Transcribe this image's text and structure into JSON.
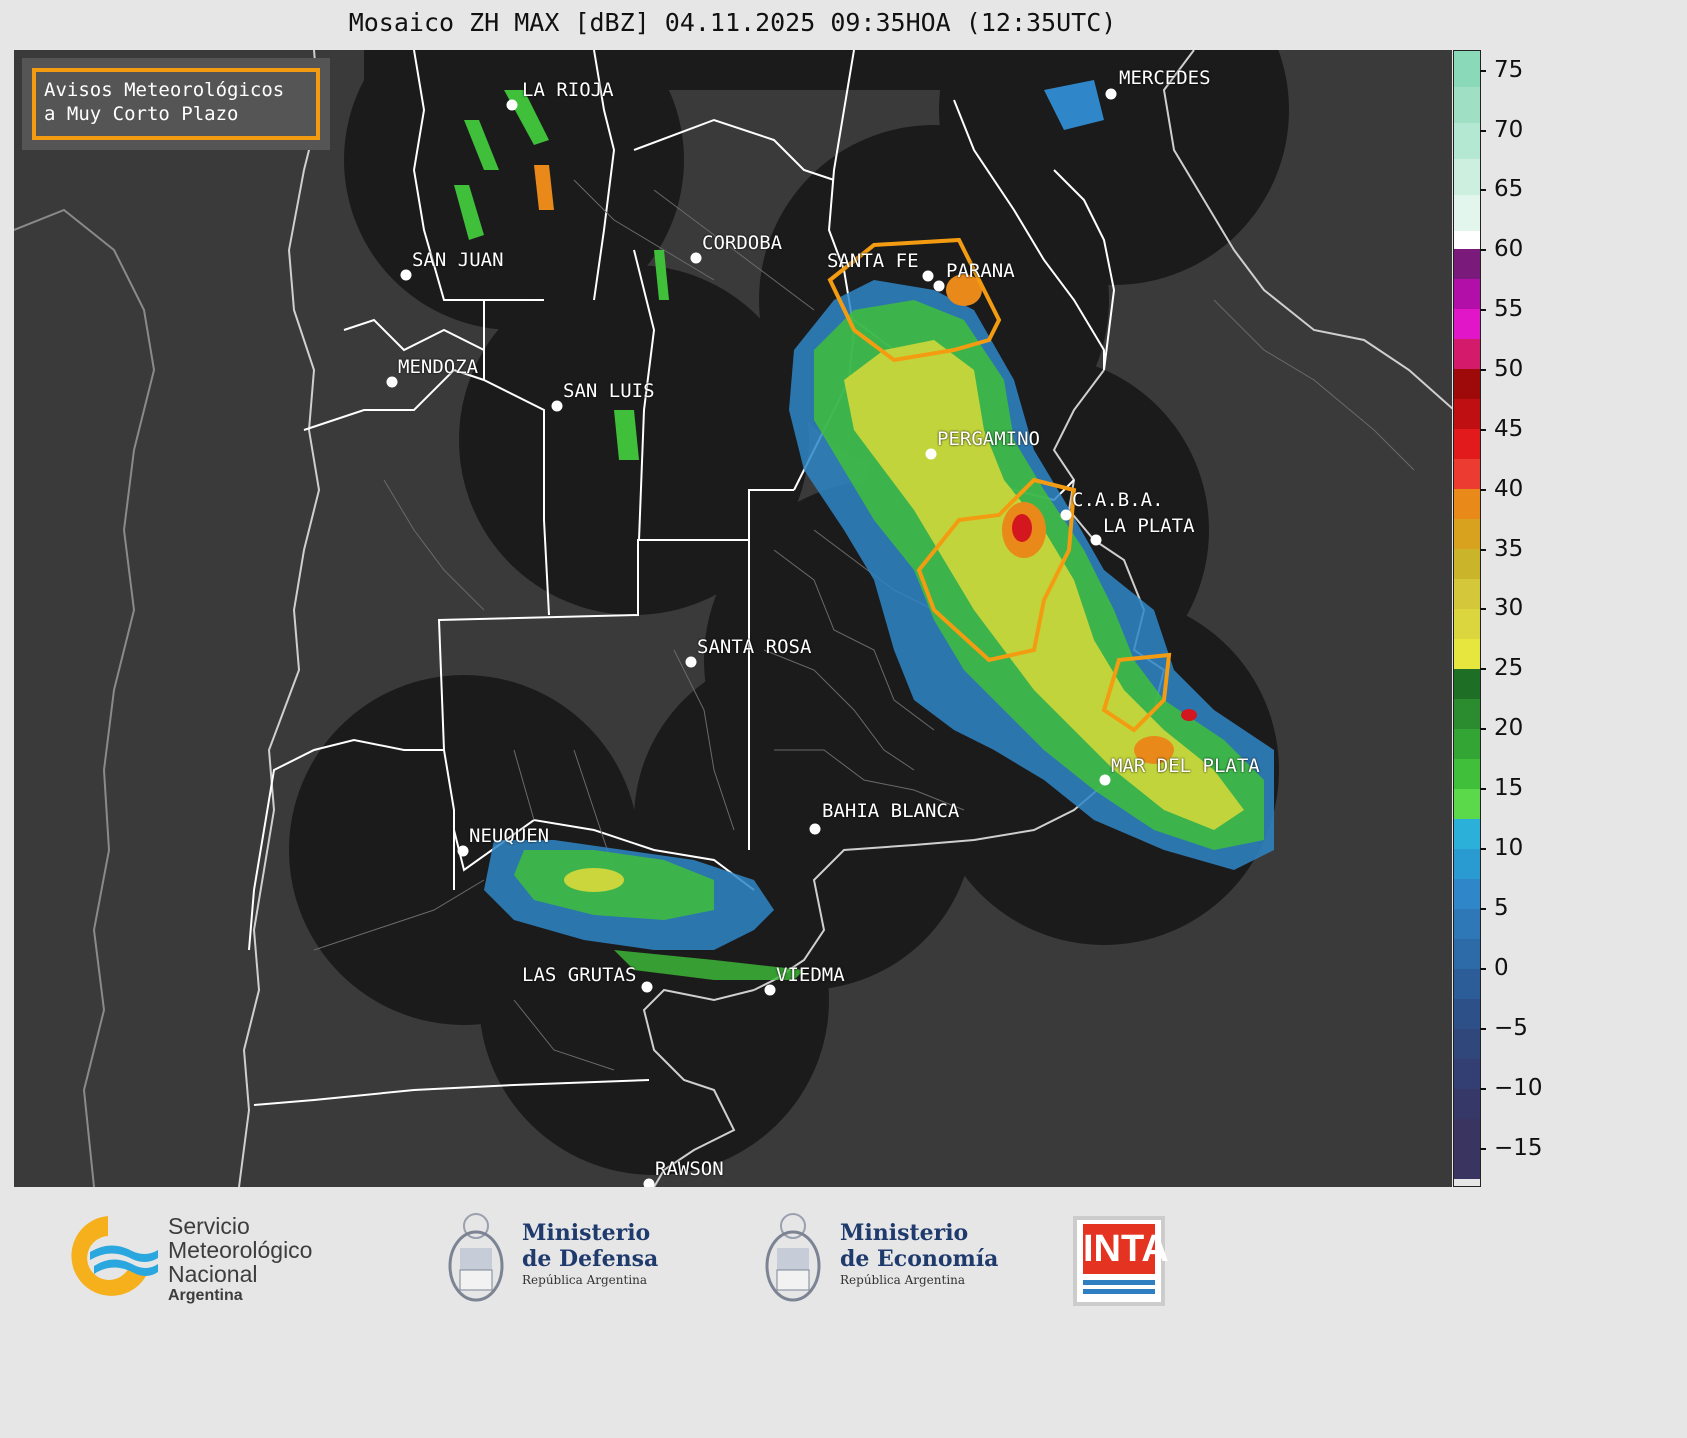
{
  "title": "Mosaico ZH MAX [dBZ] 04.11.2025 09:35HOA (12:35UTC)",
  "legend": {
    "line1": "Avisos Meteorológicos",
    "line2": "a Muy Corto Plazo",
    "border_color": "#f39c12"
  },
  "cities": [
    {
      "name": "LA RIOJA"
    },
    {
      "name": "MERCEDES"
    },
    {
      "name": "SAN JUAN"
    },
    {
      "name": "CORDOBA"
    },
    {
      "name": "SANTA FE"
    },
    {
      "name": "PARANA"
    },
    {
      "name": "MENDOZA"
    },
    {
      "name": "SAN LUIS"
    },
    {
      "name": "PERGAMINO"
    },
    {
      "name": "C.A.B.A."
    },
    {
      "name": "LA PLATA"
    },
    {
      "name": "SANTA ROSA"
    },
    {
      "name": "MAR DEL PLATA"
    },
    {
      "name": "BAHIA BLANCA"
    },
    {
      "name": "NEUQUEN"
    },
    {
      "name": "LAS GRUTAS"
    },
    {
      "name": "VIEDMA"
    },
    {
      "name": "RAWSON"
    }
  ],
  "colorbar": {
    "unit": "dBZ",
    "ticks": [
      "75",
      "70",
      "65",
      "60",
      "55",
      "50",
      "45",
      "40",
      "35",
      "30",
      "25",
      "20",
      "15",
      "10",
      "5",
      "0",
      "−5",
      "−10",
      "−15"
    ],
    "range": [
      -19,
      76
    ]
  },
  "footer": {
    "smn": {
      "line1": "Servicio",
      "line2": "Meteorológico",
      "line3": "Nacional",
      "line4": "Argentina"
    },
    "defensa": {
      "line1": "Ministerio",
      "line2": "de Defensa",
      "line3": "República Argentina"
    },
    "economia": {
      "line1": "Ministerio",
      "line2": "de Economía",
      "line3": "República Argentina"
    },
    "inta": "INTA"
  }
}
